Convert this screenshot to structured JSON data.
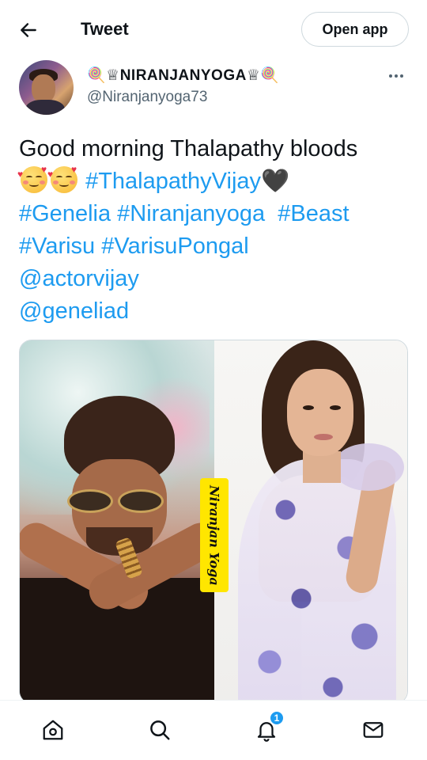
{
  "header": {
    "title": "Tweet",
    "open_app_label": "Open app"
  },
  "author": {
    "display_name": "🍭♕NIRANJANYOGA♕🍭",
    "handle": "@Niranjanyoga73"
  },
  "tweet": {
    "line1": "Good morning Thalapathy bloods",
    "line2_tag": "#ThalapathyVijay",
    "line2_glyph": "🖤",
    "line3": [
      "#Genelia",
      "#Niranjanyoga",
      "#Beast"
    ],
    "line4": [
      "#Varisu",
      "#VarisuPongal"
    ],
    "mention1": "@actorvijay",
    "mention2": "@geneliad",
    "emojis": [
      "smiling-face-with-hearts",
      "smiling-face-with-hearts"
    ]
  },
  "media": {
    "watermark_text": "Niranjan Yoga"
  },
  "bottom_nav": {
    "items": [
      "home-icon",
      "search-icon",
      "notifications-icon",
      "messages-icon"
    ],
    "notification_count": "1"
  },
  "colors": {
    "accent": "#1d9bf0",
    "text": "#0f1419",
    "secondary": "#536471",
    "watermark_bg": "#ffe600"
  }
}
